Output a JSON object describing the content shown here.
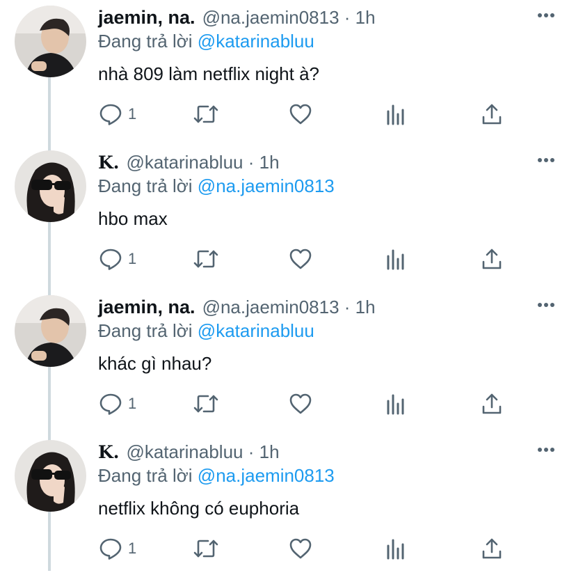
{
  "colors": {
    "accent": "#1d9bf0",
    "muted": "#536471",
    "text": "#0f1419",
    "thread_line": "#cfd9de"
  },
  "tweets": [
    {
      "display_name": "jaemin, na.",
      "handle": "@na.jaemin0813",
      "separator": "·",
      "time": "1h",
      "reply_prefix": "Đang trả lời",
      "reply_to": "@katarinabluu",
      "text": "nhà 809 làm netflix night à?",
      "reply_count": "1",
      "avatar": "avatar-jaemin"
    },
    {
      "display_name": "K.",
      "handle": "@katarinabluu",
      "separator": "·",
      "time": "1h",
      "reply_prefix": "Đang trả lời",
      "reply_to": "@na.jaemin0813",
      "text": "hbo max",
      "reply_count": "1",
      "avatar": "avatar-katarina"
    },
    {
      "display_name": "jaemin, na.",
      "handle": "@na.jaemin0813",
      "separator": "·",
      "time": "1h",
      "reply_prefix": "Đang trả lời",
      "reply_to": "@katarinabluu",
      "text": "khác gì nhau?",
      "reply_count": "1",
      "avatar": "avatar-jaemin"
    },
    {
      "display_name": "K.",
      "handle": "@katarinabluu",
      "separator": "·",
      "time": "1h",
      "reply_prefix": "Đang trả lời",
      "reply_to": "@na.jaemin0813",
      "text": "netflix không có euphoria",
      "reply_count": "1",
      "avatar": "avatar-katarina"
    }
  ],
  "icons": [
    "reply-icon",
    "retweet-icon",
    "like-icon",
    "analytics-icon",
    "share-icon",
    "more-icon"
  ]
}
